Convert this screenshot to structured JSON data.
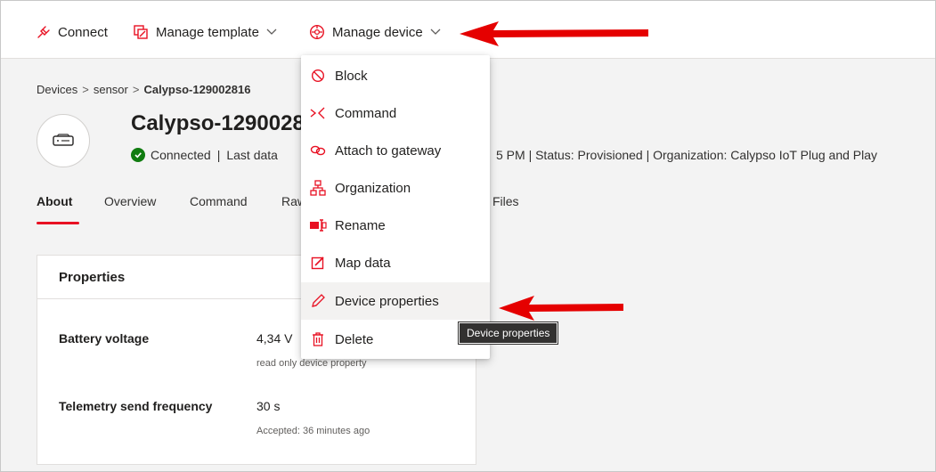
{
  "toolbar": {
    "connect_label": "Connect",
    "manage_template_label": "Manage template",
    "manage_device_label": "Manage device"
  },
  "breadcrumb": {
    "items": [
      "Devices",
      "sensor",
      "Calypso-129002816"
    ]
  },
  "device": {
    "title": "Calypso-12900281",
    "status_connected": "Connected",
    "status_sep": "|",
    "last_data_prefix": "Last data",
    "status_rest": "5 PM  |  Status: Provisioned  |  Organization: Calypso IoT Plug and Play"
  },
  "tabs": [
    "About",
    "Overview",
    "Command",
    "Raw data",
    "Files"
  ],
  "properties": {
    "header": "Properties",
    "rows": [
      {
        "name": "Battery voltage",
        "value": "4,34 V",
        "note": "read only device property"
      },
      {
        "name": "Telemetry send frequency",
        "value": "30 s",
        "note": "Accepted: 36 minutes ago"
      }
    ]
  },
  "menu": {
    "items": [
      {
        "label": "Block",
        "icon": "block-icon"
      },
      {
        "label": "Command",
        "icon": "command-icon"
      },
      {
        "label": "Attach to gateway",
        "icon": "gateway-icon"
      },
      {
        "label": "Organization",
        "icon": "organization-icon"
      },
      {
        "label": "Rename",
        "icon": "rename-icon"
      },
      {
        "label": "Map data",
        "icon": "map-data-icon"
      },
      {
        "label": "Device properties",
        "icon": "pencil-icon"
      },
      {
        "label": "Delete",
        "icon": "trash-icon"
      }
    ]
  },
  "tooltip": "Device properties",
  "colors": {
    "accent": "#e81123",
    "connected": "#107c10",
    "arrow": "#e50000"
  }
}
